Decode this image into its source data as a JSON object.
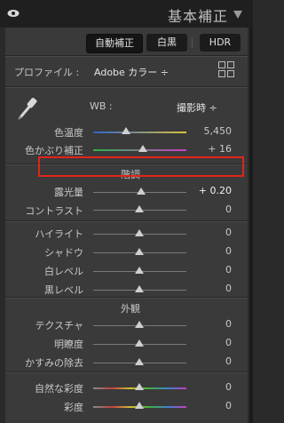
{
  "panel": {
    "title": "基本補正"
  },
  "treatment": {
    "auto": "自動補正",
    "bw": "白黒",
    "hdr": "HDR"
  },
  "profile": {
    "label": "プロファイル :",
    "value": "Adobe カラー ÷"
  },
  "wb": {
    "label": "WB :",
    "value": "撮影時 ÷"
  },
  "sliders": {
    "temp": {
      "label": "色温度",
      "value": "5,450"
    },
    "tint": {
      "label": "色かぶり補正",
      "value": "+ 16"
    },
    "exposure": {
      "label": "露光量",
      "value": "+ 0.20"
    },
    "contrast": {
      "label": "コントラスト",
      "value": "0"
    },
    "highlights": {
      "label": "ハイライト",
      "value": "0"
    },
    "shadows": {
      "label": "シャドウ",
      "value": "0"
    },
    "whites": {
      "label": "白レベル",
      "value": "0"
    },
    "blacks": {
      "label": "黒レベル",
      "value": "0"
    },
    "texture": {
      "label": "テクスチャ",
      "value": "0"
    },
    "clarity": {
      "label": "明瞭度",
      "value": "0"
    },
    "dehaze": {
      "label": "かすみの除去",
      "value": "0"
    },
    "vibrance": {
      "label": "自然な彩度",
      "value": "0"
    },
    "saturation": {
      "label": "彩度",
      "value": "0"
    }
  },
  "sections": {
    "tone": "階調",
    "presence": "外観"
  },
  "colors": {
    "highlight": "#e32318",
    "active_bg": "#151515"
  },
  "icons": {
    "visibility": "eye-icon",
    "collapse": "triangle-down-icon",
    "profile_browser": "grid-icon",
    "wb_selector": "eyedropper-icon"
  }
}
